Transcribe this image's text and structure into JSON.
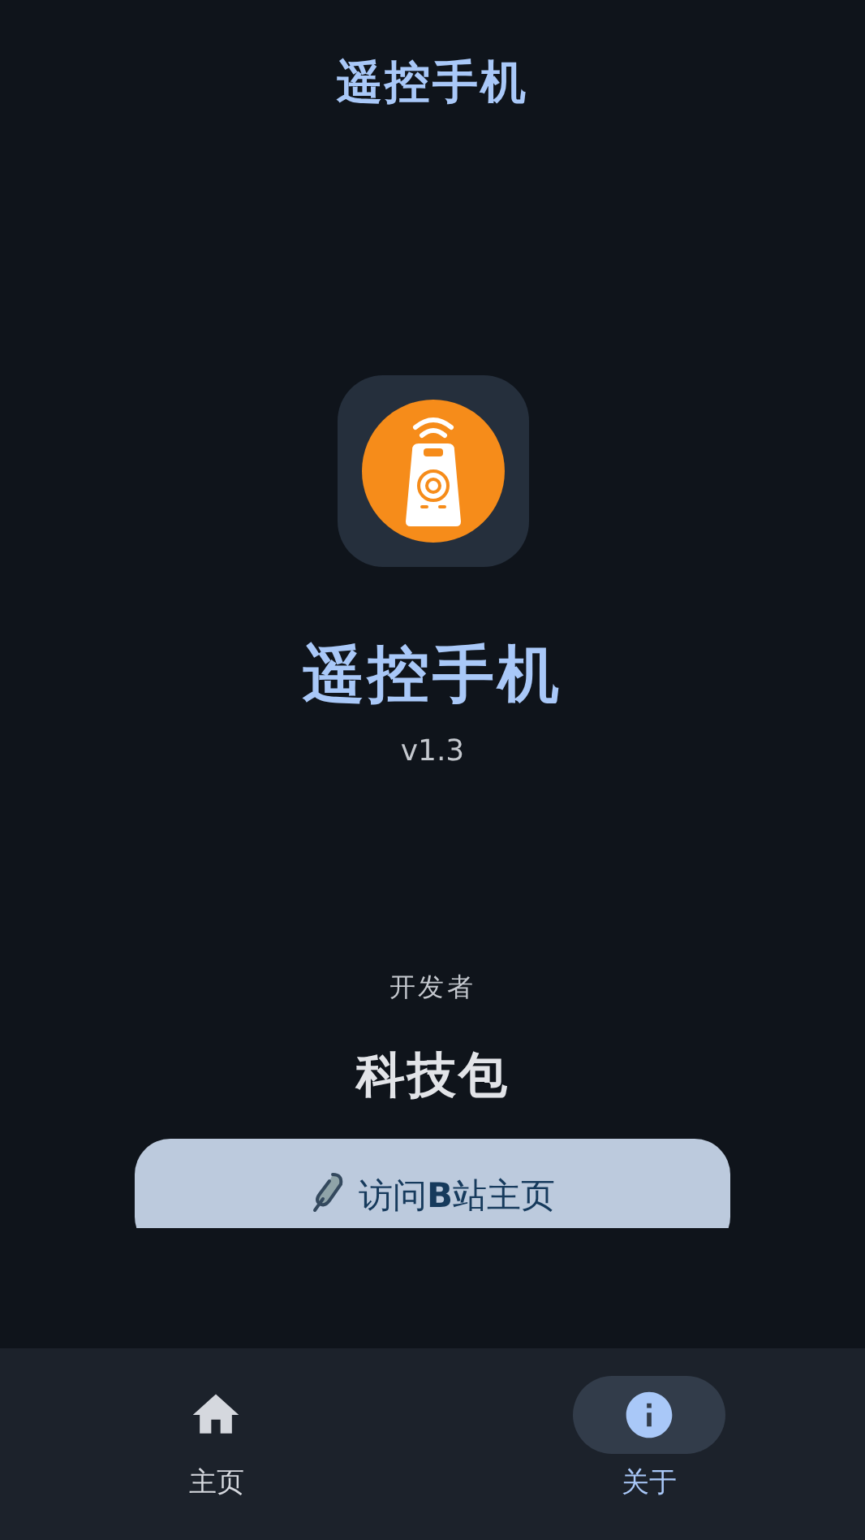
{
  "header": {
    "title": "遥控手机"
  },
  "app": {
    "name": "遥控手机",
    "version": "v1.3"
  },
  "developer": {
    "label": "开发者",
    "name": "科技包"
  },
  "link_button": {
    "label": "访问**B**站主页"
  },
  "nav": [
    {
      "label": "主页",
      "kind": "home",
      "selected": false
    },
    {
      "label": "关于",
      "kind": "info",
      "selected": true
    }
  ]
}
